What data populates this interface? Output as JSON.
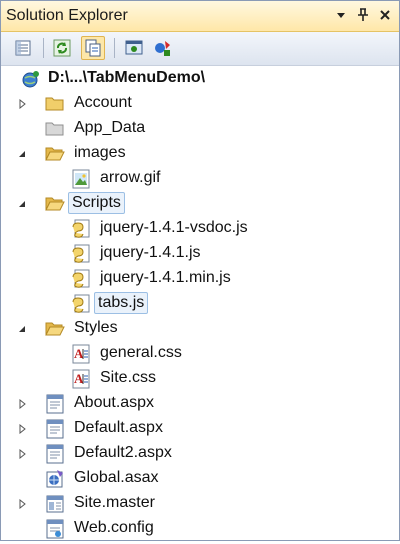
{
  "title": "Solution Explorer",
  "title_buttons": [
    "dropdown-icon",
    "pin-icon",
    "close-icon"
  ],
  "toolbar": {
    "buttons": [
      "properties-icon",
      "refresh-icon",
      "nest-files-icon",
      "view-designer-icon",
      "class-diagram-icon"
    ]
  },
  "tree": {
    "root": "D:\\...\\TabMenuDemo\\",
    "items": [
      {
        "label": "Account",
        "icon": "folder-icon",
        "expander": "collapsed"
      },
      {
        "label": "App_Data",
        "icon": "folder-gray-icon",
        "expander": "none"
      },
      {
        "label": "images",
        "icon": "folder-open-icon",
        "expander": "expanded"
      },
      {
        "label": "arrow.gif",
        "icon": "image-file-icon",
        "expander": "none"
      },
      {
        "label": "Scripts",
        "icon": "folder-open-icon",
        "expander": "expanded"
      },
      {
        "label": "jquery-1.4.1-vsdoc.js",
        "icon": "js-file-icon",
        "expander": "none"
      },
      {
        "label": "jquery-1.4.1.js",
        "icon": "js-file-icon",
        "expander": "none"
      },
      {
        "label": "jquery-1.4.1.min.js",
        "icon": "js-file-icon",
        "expander": "none"
      },
      {
        "label": "tabs.js",
        "icon": "js-file-icon",
        "expander": "none"
      },
      {
        "label": "Styles",
        "icon": "folder-open-icon",
        "expander": "expanded"
      },
      {
        "label": "general.css",
        "icon": "css-file-icon",
        "expander": "none"
      },
      {
        "label": "Site.css",
        "icon": "css-file-icon",
        "expander": "none"
      },
      {
        "label": "About.aspx",
        "icon": "aspx-file-icon",
        "expander": "collapsed"
      },
      {
        "label": "Default.aspx",
        "icon": "aspx-file-icon",
        "expander": "collapsed"
      },
      {
        "label": "Default2.aspx",
        "icon": "aspx-file-icon",
        "expander": "collapsed"
      },
      {
        "label": "Global.asax",
        "icon": "global-asax-icon",
        "expander": "none"
      },
      {
        "label": "Site.master",
        "icon": "master-file-icon",
        "expander": "collapsed"
      },
      {
        "label": "Web.config",
        "icon": "config-file-icon",
        "expander": "none"
      }
    ]
  },
  "colors": {
    "selection_border": "#9cbfe4",
    "selection_fill": "#eaf2fb",
    "title_bar": "#ffe7a8"
  }
}
